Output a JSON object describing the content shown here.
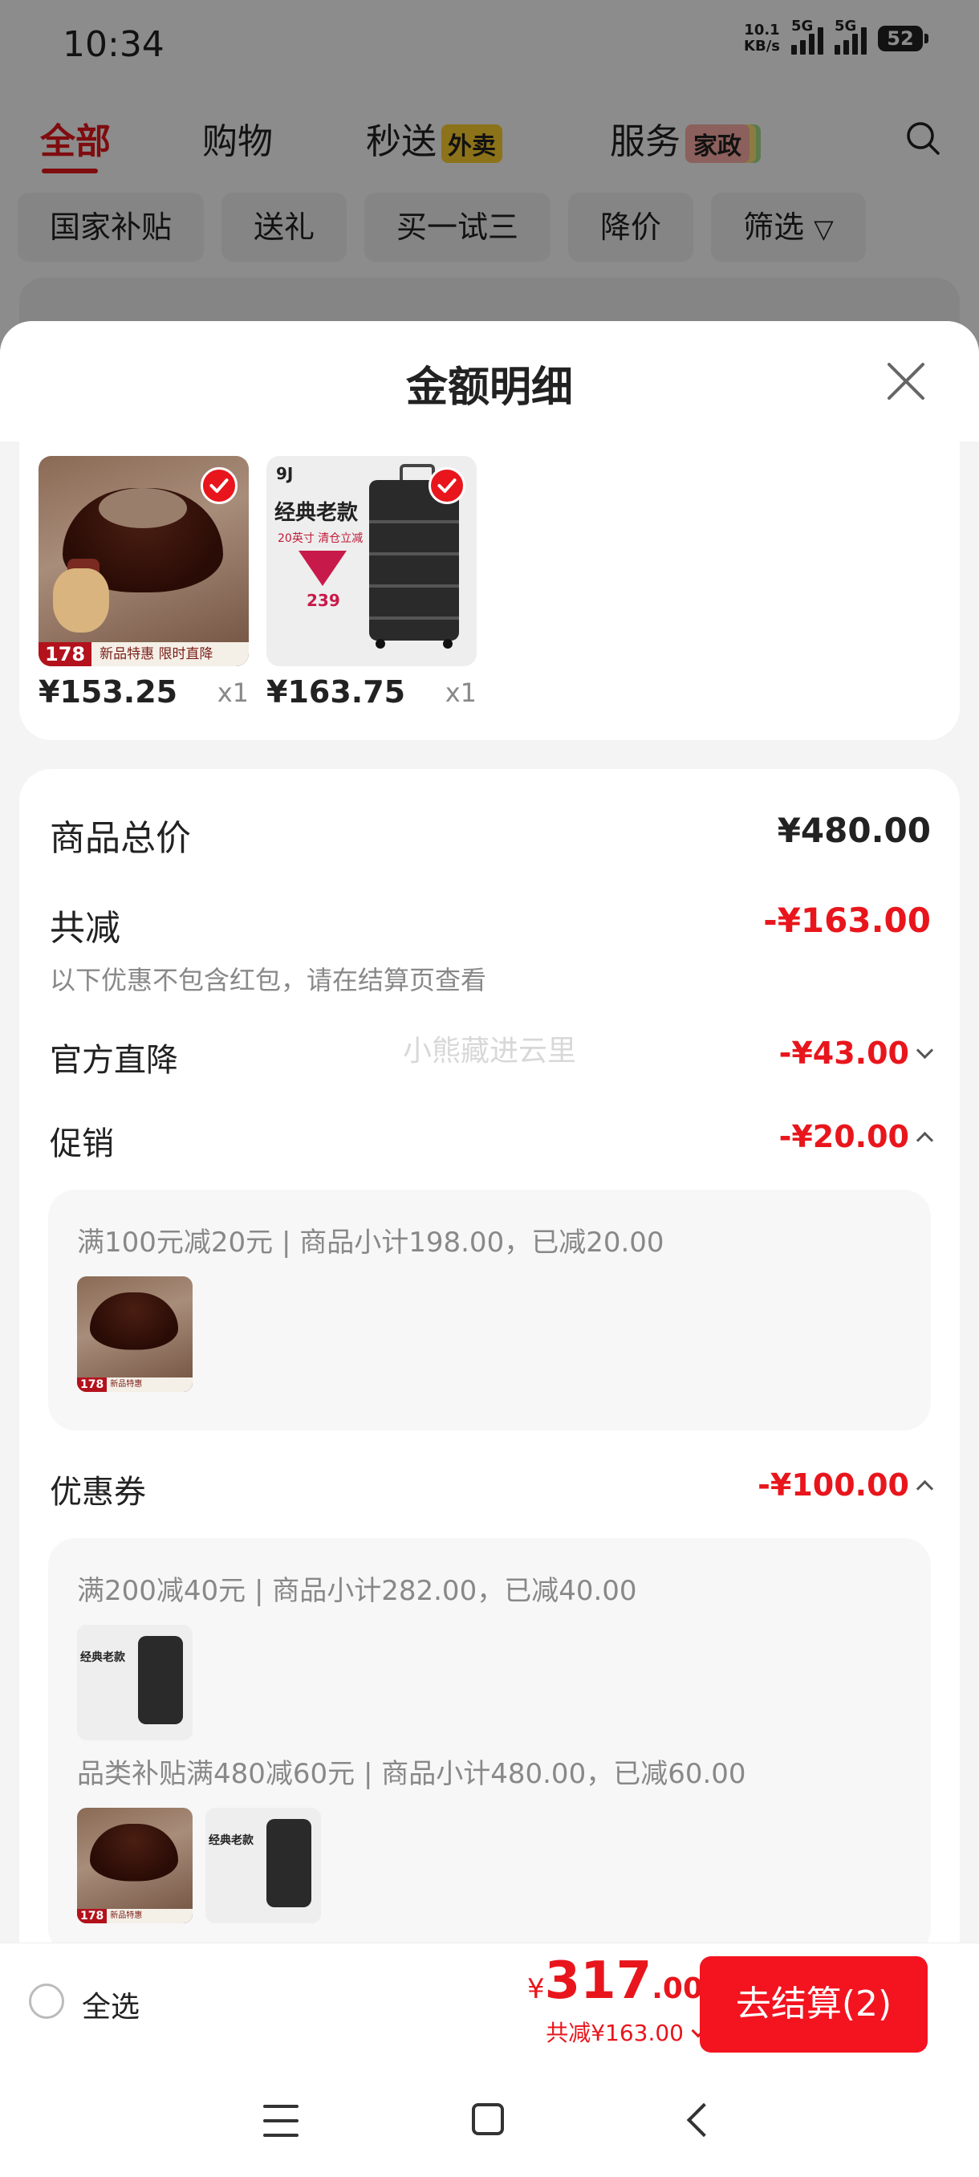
{
  "status_bar": {
    "time": "10:34",
    "net_speed_value": "10.1",
    "net_speed_unit": "KB/s",
    "sim1": "5G",
    "sim2": "5G",
    "battery": "52"
  },
  "top_nav": {
    "tabs": [
      {
        "label": "全部",
        "active": true
      },
      {
        "label": "购物"
      },
      {
        "label": "秒送",
        "tag": "外卖"
      },
      {
        "label": "服务",
        "tag": "家政"
      }
    ],
    "search_icon": "search-icon"
  },
  "filter_chips": [
    "国家补贴",
    "送礼",
    "买一试三",
    "降价",
    "筛选"
  ],
  "sheet": {
    "title": "金额明细",
    "products": [
      {
        "price": "¥153.25",
        "qty": "x1",
        "badge_price": "178",
        "badge_text": "新品特惠 限时直降"
      },
      {
        "price": "¥163.75",
        "qty": "x1",
        "brand_mark": "9J",
        "headline": "经典老款",
        "sub": "20英寸 清仓立减",
        "promo_price": "239"
      }
    ],
    "summary": {
      "total_label": "商品总价",
      "total_value": "¥480.00",
      "reduce_label": "共减",
      "reduce_value": "-¥163.00",
      "reduce_note": "以下优惠不包含红包，请在结算页查看",
      "watermark": "小熊藏进云里"
    },
    "items": [
      {
        "label": "官方直降",
        "value": "-¥43.00",
        "expanded": false
      },
      {
        "label": "促销",
        "value": "-¥20.00",
        "expanded": true,
        "details": [
          {
            "text": "满100元减20元 | 商品小计198.00，已减20.00"
          }
        ]
      },
      {
        "label": "优惠券",
        "value": "-¥100.00",
        "expanded": true,
        "details": [
          {
            "text": "满200减40元 | 商品小计282.00，已减40.00"
          },
          {
            "text": "品类补贴满480减60元 | 商品小计480.00，已减60.00"
          }
        ]
      }
    ]
  },
  "bottom_bar": {
    "select_all": "全选",
    "currency": "¥",
    "total_int": "317",
    "total_dec": ".00",
    "reduce_text": "共减¥163.00",
    "checkout_label": "去结算(2)"
  },
  "colors": {
    "accent": "#e8161c",
    "checkout_bg": "#f31420",
    "tag_yellow": "#ffd12e"
  }
}
